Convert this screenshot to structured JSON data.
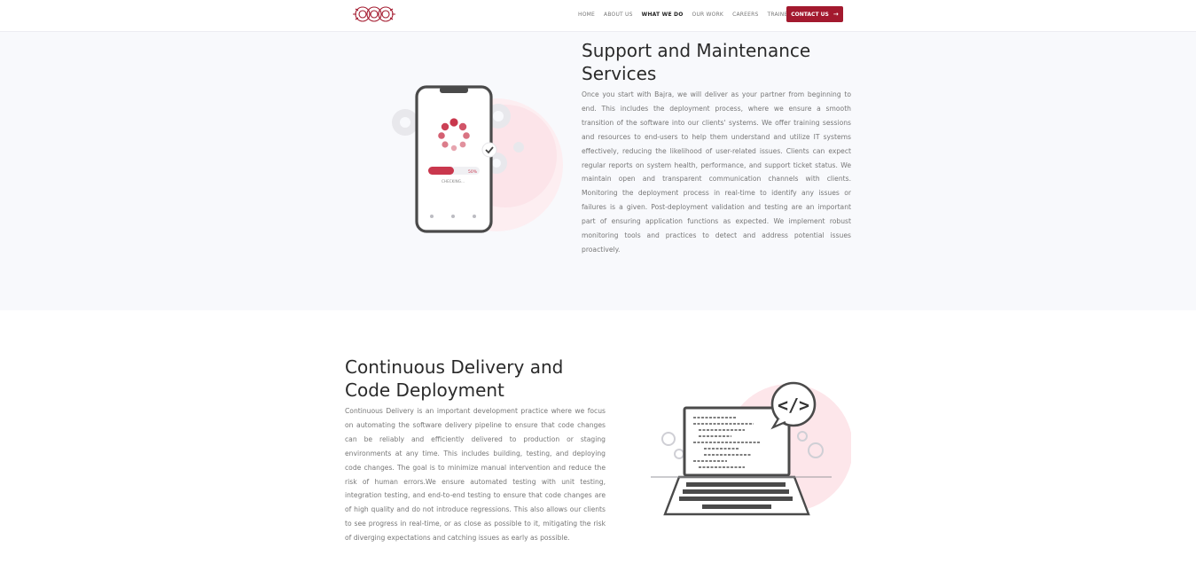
{
  "nav": {
    "links": [
      {
        "label": "HOME",
        "active": false
      },
      {
        "label": "ABOUT US",
        "active": false
      },
      {
        "label": "WHAT WE DO",
        "active": true
      },
      {
        "label": "OUR WORK",
        "active": false
      },
      {
        "label": "CAREERS",
        "active": false
      },
      {
        "label": "TRAINEESHIP",
        "active": false
      }
    ],
    "contact_label": "CONTACT US",
    "contact_icon": "arrow-right-icon"
  },
  "support": {
    "title_line1": "Support and Maintenance",
    "title_line2": "Services",
    "body": "Once you start with Bajra, we will deliver as your partner from beginning to end. This includes the deployment process, where we ensure a smooth transition of the software into our clients' systems. We offer training sessions and resources to end-users to help them understand and utilize IT systems effectively, reducing the likelihood of user-related issues. Clients can expect regular reports on system health, performance, and support ticket status. We maintain open and transparent communication channels with clients. Monitoring the deployment process in real-time to identify any issues or failures is a given. Post-deployment validation and testing are an important part of ensuring application functions as expected. We implement robust monitoring tools and practices to detect and address potential issues proactively.",
    "illustration": {
      "progress_label": "CHECKING...",
      "progress_percent_label": "50%",
      "progress_value": 0.5
    }
  },
  "delivery": {
    "title_line1": "Continuous Delivery and",
    "title_line2": "Code Deployment",
    "body": "Continuous Delivery is an important development practice where we focus on automating the software delivery pipeline to ensure that code changes can be reliably and efficiently delivered to production or staging environments at any time. This includes building, testing, and deploying code changes. The goal is to minimize manual intervention and reduce the risk of human errors.We ensure automated testing with unit testing, integration testing, and end-to-end testing to ensure that code changes are of high quality and do not introduce regressions. This also allows our clients to see progress in real-time, or as close as possible to it, mitigating the risk of diverging expectations and catching issues as early as possible.",
    "illustration": {
      "badge_text": "</>"
    }
  },
  "colors": {
    "brand": "#a3192e",
    "section_bg": "#f8f9fc",
    "accent_pink": "#fde6ea"
  }
}
